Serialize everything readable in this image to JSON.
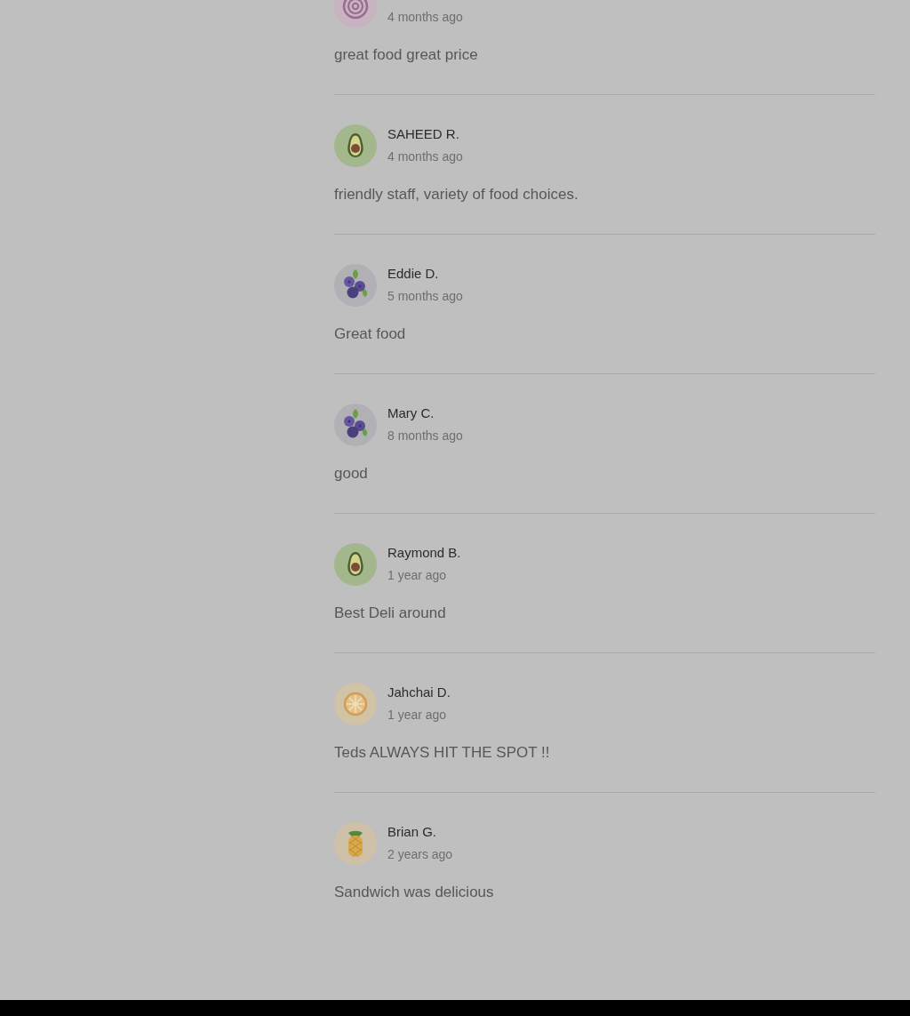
{
  "reviews": [
    {
      "avatar": {
        "kind": "onion"
      },
      "time": "4 months ago",
      "text": "great food great price"
    },
    {
      "avatar": {
        "kind": "avocado"
      },
      "name": "SAHEED R.",
      "time": "4 months ago",
      "text": "friendly staff, variety of food choices."
    },
    {
      "avatar": {
        "kind": "berries"
      },
      "name": "Eddie D.",
      "time": "5 months ago",
      "text": "Great food"
    },
    {
      "avatar": {
        "kind": "berries"
      },
      "name": "Mary C.",
      "time": "8 months ago",
      "text": "good"
    },
    {
      "avatar": {
        "kind": "avocado"
      },
      "name": "Raymond B.",
      "time": "1 year ago",
      "text": "Best Deli around"
    },
    {
      "avatar": {
        "kind": "citrus"
      },
      "name": "Jahchai D.",
      "time": "1 year ago",
      "text": "Teds ALWAYS HIT THE SPOT !!"
    },
    {
      "avatar": {
        "kind": "pineapple"
      },
      "name": "Brian G.",
      "time": "2 years ago",
      "text": "Sandwich was delicious"
    }
  ]
}
